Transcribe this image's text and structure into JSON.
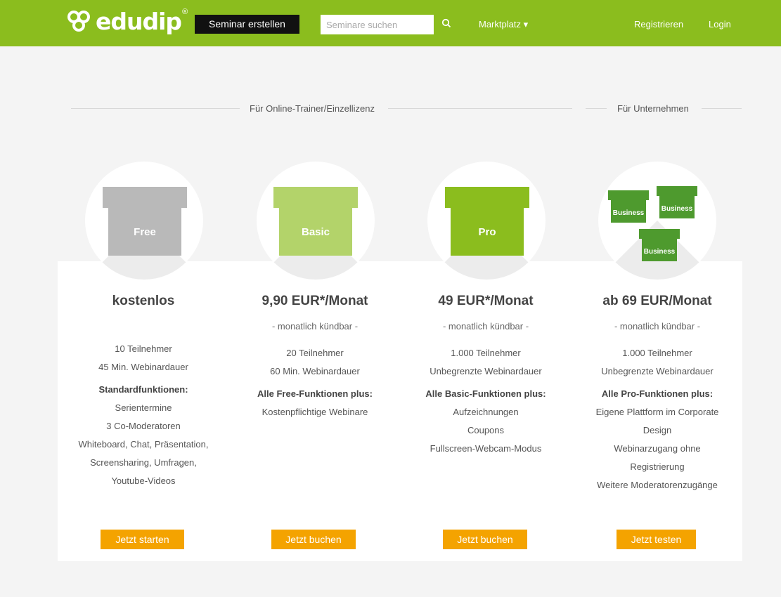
{
  "header": {
    "logo_text": "edudip",
    "logo_reg": "®",
    "create_button": "Seminar erstellen",
    "search_placeholder": "Seminare suchen",
    "marketplace": "Marktplatz ▾",
    "register": "Registrieren",
    "login": "Login"
  },
  "sections": {
    "trainer": "Für Online-Trainer/Einzellizenz",
    "business": "Für Unternehmen"
  },
  "plans": [
    {
      "box_label": "Free",
      "price": "kostenlos",
      "cancel": "",
      "lines_a": [
        "10 Teilnehmer",
        "45 Min. Webinardauer"
      ],
      "heading": "Standardfunktionen:",
      "lines_b": [
        "Serientermine",
        "3 Co-Moderatoren",
        "Whiteboard, Chat, Präsentation,",
        "Screensharing, Umfragen,",
        "Youtube-Videos"
      ],
      "cta": "Jetzt starten"
    },
    {
      "box_label": "Basic",
      "price": "9,90 EUR*/Monat",
      "cancel": "- monatlich kündbar -",
      "lines_a": [
        "20 Teilnehmer",
        "60 Min. Webinardauer"
      ],
      "heading": "Alle Free-Funktionen plus:",
      "lines_b": [
        "Kostenpflichtige Webinare"
      ],
      "cta": "Jetzt buchen"
    },
    {
      "box_label": "Pro",
      "price": "49 EUR*/Monat",
      "cancel": "- monatlich kündbar -",
      "lines_a": [
        "1.000 Teilnehmer",
        "Unbegrenzte Webinardauer"
      ],
      "heading": "Alle Basic-Funktionen plus:",
      "lines_b": [
        "Aufzeichnungen",
        "Coupons",
        "Fullscreen-Webcam-Modus"
      ],
      "cta": "Jetzt buchen"
    },
    {
      "box_label": "Business",
      "price": "ab 69 EUR/Monat",
      "cancel": "- monatlich kündbar -",
      "lines_a": [
        "1.000 Teilnehmer",
        "Unbegrenzte Webinardauer"
      ],
      "heading": "Alle Pro-Funktionen plus:",
      "lines_b": [
        "Eigene Plattform im Corporate",
        "Design",
        "Webinarzugang ohne",
        "Registrierung",
        "Weitere Moderatorenzugänge"
      ],
      "cta": "Jetzt testen"
    }
  ],
  "colors": {
    "brand_green": "#8bbd1e",
    "free_box": "#b9b9b9",
    "basic_box": "#b3d36a",
    "pro_box": "#8bbd1e",
    "business_box": "#4e9a2e",
    "cta_orange": "#f4a300"
  }
}
